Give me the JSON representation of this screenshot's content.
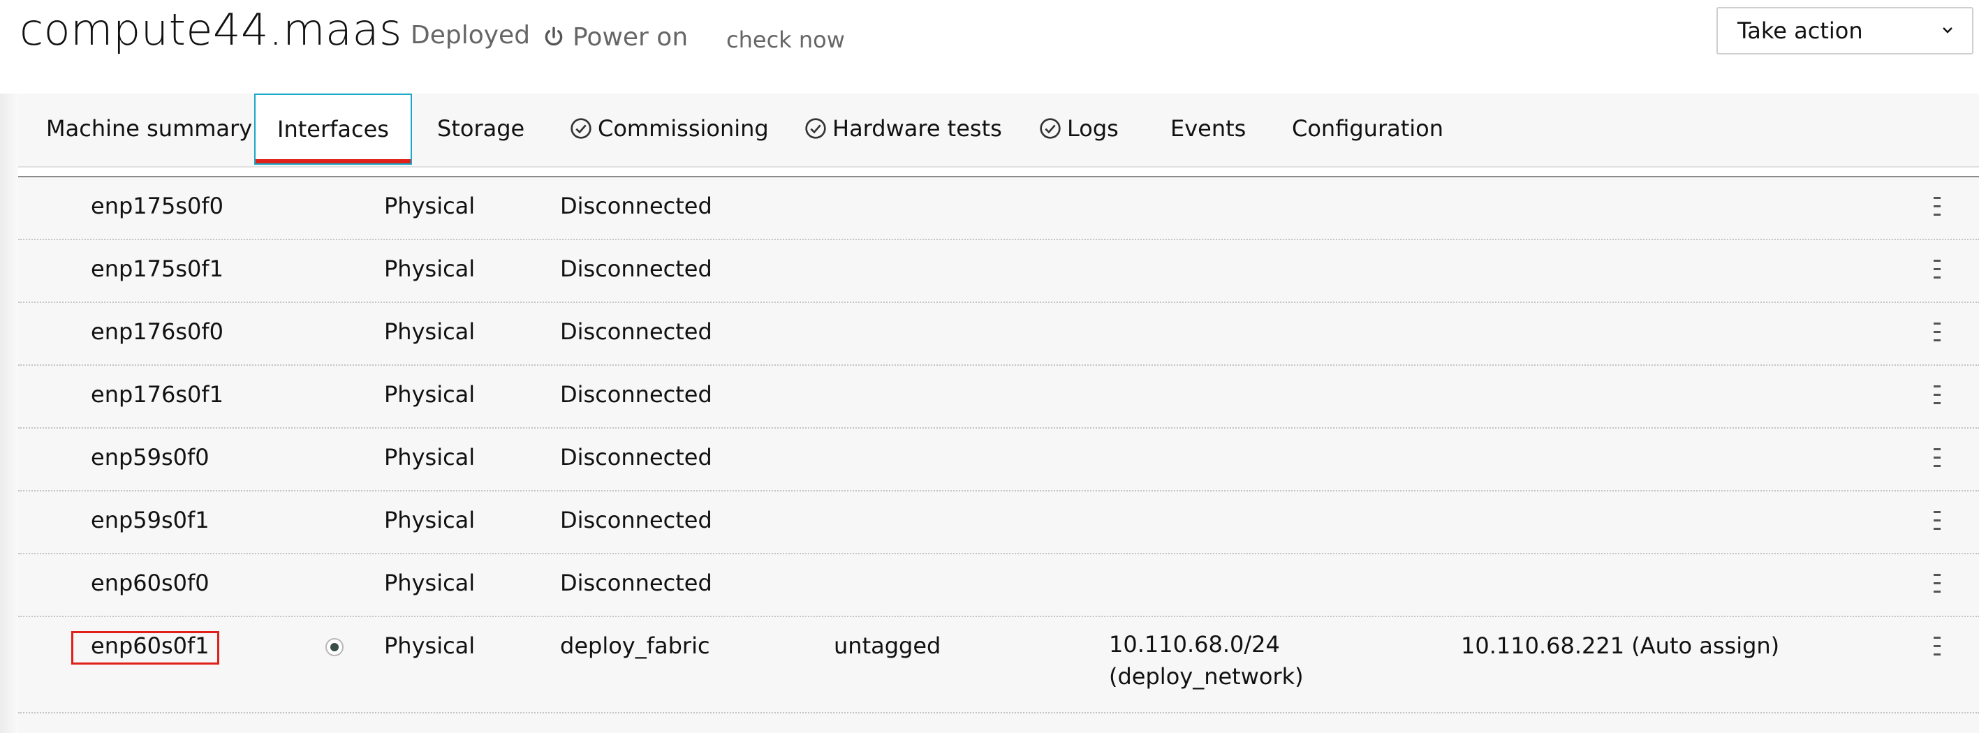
{
  "header": {
    "machine_name": "compute44.maas",
    "status": "Deployed",
    "power_label": "Power on",
    "check_now": "check now",
    "take_action": "Take action"
  },
  "tabs": [
    {
      "label": "Machine summary",
      "icon": ""
    },
    {
      "label": "Interfaces",
      "icon": "",
      "active": true
    },
    {
      "label": "Storage",
      "icon": ""
    },
    {
      "label": "Commissioning",
      "icon": "check-circle-icon"
    },
    {
      "label": "Hardware tests",
      "icon": "check-circle-icon"
    },
    {
      "label": "Logs",
      "icon": "check-circle-icon"
    },
    {
      "label": "Events",
      "icon": ""
    },
    {
      "label": "Configuration",
      "icon": ""
    }
  ],
  "interfaces": [
    {
      "name": "enp175s0f0",
      "type": "Physical",
      "fabric": "Disconnected",
      "vlan": "",
      "subnet": "",
      "subnet_name": "",
      "ip": ""
    },
    {
      "name": "enp175s0f1",
      "type": "Physical",
      "fabric": "Disconnected",
      "vlan": "",
      "subnet": "",
      "subnet_name": "",
      "ip": ""
    },
    {
      "name": "enp176s0f0",
      "type": "Physical",
      "fabric": "Disconnected",
      "vlan": "",
      "subnet": "",
      "subnet_name": "",
      "ip": ""
    },
    {
      "name": "enp176s0f1",
      "type": "Physical",
      "fabric": "Disconnected",
      "vlan": "",
      "subnet": "",
      "subnet_name": "",
      "ip": ""
    },
    {
      "name": "enp59s0f0",
      "type": "Physical",
      "fabric": "Disconnected",
      "vlan": "",
      "subnet": "",
      "subnet_name": "",
      "ip": ""
    },
    {
      "name": "enp59s0f1",
      "type": "Physical",
      "fabric": "Disconnected",
      "vlan": "",
      "subnet": "",
      "subnet_name": "",
      "ip": ""
    },
    {
      "name": "enp60s0f0",
      "type": "Physical",
      "fabric": "Disconnected",
      "vlan": "",
      "subnet": "",
      "subnet_name": "",
      "ip": ""
    },
    {
      "name": "enp60s0f1",
      "type": "Physical",
      "fabric": "deploy_fabric",
      "vlan": "untagged",
      "subnet": "10.110.68.0/24",
      "subnet_name": "(deploy_network)",
      "ip": "10.110.68.221 (Auto assign)",
      "pxe": true,
      "highlighted": true
    }
  ],
  "colors": {
    "accent_tab_border": "#19a8c8",
    "active_tab_underline": "#e0201a",
    "highlight_box": "#e0201a",
    "pxe_dot": "#3b4d48"
  }
}
